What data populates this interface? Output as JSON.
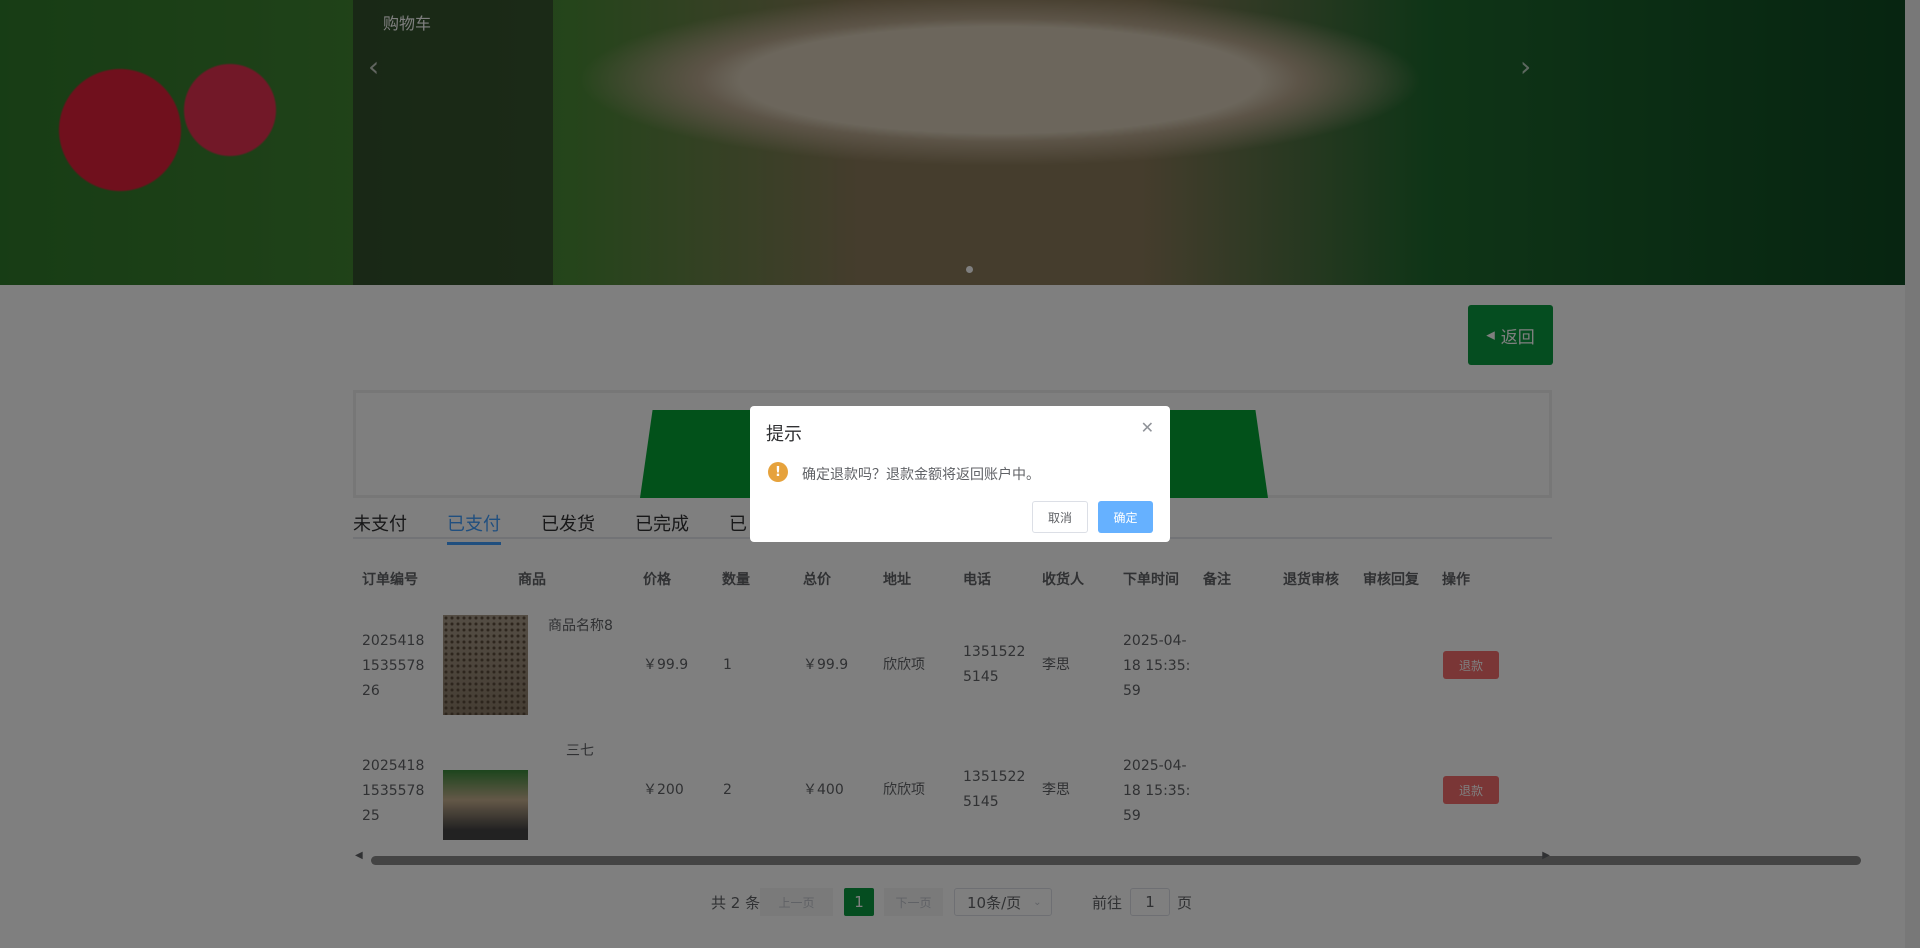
{
  "nav": {
    "cart": "购物车"
  },
  "back": {
    "label": "返回"
  },
  "tabs": [
    "未支付",
    "已支付",
    "已发货",
    "已完成",
    "已"
  ],
  "table": {
    "headers": [
      "订单编号",
      "商品",
      "价格",
      "数量",
      "总价",
      "地址",
      "电话",
      "收货人",
      "下单时间",
      "备注",
      "退货审核",
      "审核回复",
      "操作"
    ],
    "rows": [
      {
        "order_no": [
          "2025418",
          "1535578",
          "26"
        ],
        "product": "商品名称8",
        "price": "￥99.9",
        "qty": "1",
        "total": "￥99.9",
        "address": "欣欣项",
        "phone": [
          "1351522",
          "5145"
        ],
        "receiver": "李思",
        "time": [
          "2025-04-",
          "18 15:35:",
          "59"
        ],
        "action": "退款"
      },
      {
        "order_no": [
          "2025418",
          "1535578",
          "25"
        ],
        "product": "三七",
        "price": "￥200",
        "qty": "2",
        "total": "￥400",
        "address": "欣欣项",
        "phone": [
          "1351522",
          "5145"
        ],
        "receiver": "李思",
        "time": [
          "2025-04-",
          "18 15:35:",
          "59"
        ],
        "action": "退款"
      }
    ]
  },
  "pagination": {
    "total": "共 2 条",
    "prev": "上一页",
    "current": "1",
    "next": "下一页",
    "size": "10条/页",
    "goto": "前往",
    "goto_value": "1",
    "page": "页"
  },
  "dialog": {
    "title": "提示",
    "message": "确定退款吗？退款金额将返回账户中。",
    "cancel": "取消",
    "confirm": "确定"
  },
  "colors": {
    "green": "#0b9a40",
    "primary": "#409eff",
    "danger": "#f56c6c",
    "warning": "#e6a23c"
  }
}
